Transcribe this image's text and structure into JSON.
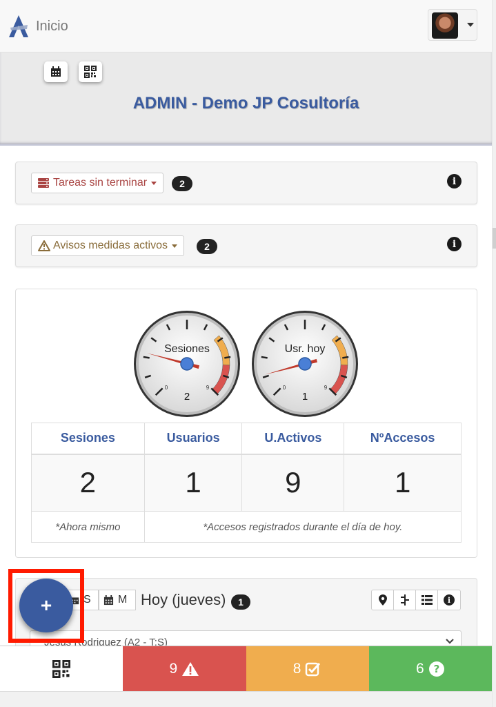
{
  "nav": {
    "brand": "Inicio"
  },
  "header": {
    "title": "ADMIN - Demo JP Cosultoría",
    "tools": [
      "calendar-icon",
      "qrcode-icon"
    ]
  },
  "tareas": {
    "label": "Tareas sin terminar",
    "count": "2",
    "color": "#a94442"
  },
  "avisos": {
    "label": "Avisos medidas activos",
    "count": "2",
    "color": "#8a6d3b"
  },
  "gauges": [
    {
      "label": "Sesiones",
      "value": "2",
      "min": "0",
      "max": "9"
    },
    {
      "label": "Usr. hoy",
      "value": "1",
      "min": "0",
      "max": "9"
    }
  ],
  "stats": {
    "headers": [
      "Sesiones",
      "Usuarios",
      "U.Activos",
      "NºAccesos"
    ],
    "values": [
      "2",
      "1",
      "9",
      "1"
    ],
    "notes": [
      "*Ahora mismo",
      "*Accesos registrados durante el día de hoy."
    ]
  },
  "agenda": {
    "seg_s": "S",
    "seg_m": "M",
    "title": "Hoy (jueves)",
    "count": "1",
    "select_text": "Jesus Rodriguez (A2 - T:S)"
  },
  "fab": {
    "label": "+"
  },
  "bottom": {
    "alerts": "9",
    "tasks": "8",
    "help": "6"
  },
  "colors": {
    "accent": "#3a5b9f",
    "danger": "#d9534f",
    "warning": "#f0ad4e",
    "success": "#5cb85c"
  }
}
